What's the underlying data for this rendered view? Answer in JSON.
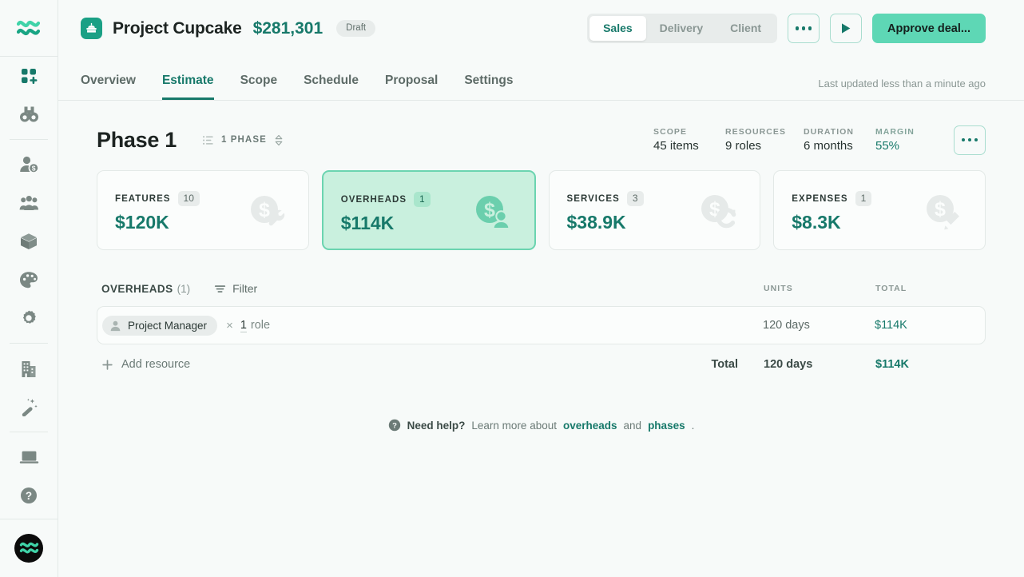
{
  "sidebar": {
    "logo_icon": "waves-logo-icon",
    "items": [
      {
        "icon": "grid-plus-icon",
        "name": "sidebar-item-dashboard",
        "active": true
      },
      {
        "icon": "binoculars-icon",
        "name": "sidebar-item-discover",
        "active": false
      },
      {
        "icon": "person-dollar-icon",
        "name": "sidebar-item-deals",
        "active": false
      },
      {
        "icon": "team-icon",
        "name": "sidebar-item-team",
        "active": false
      },
      {
        "icon": "box-icon",
        "name": "sidebar-item-products",
        "active": false
      },
      {
        "icon": "palette-icon",
        "name": "sidebar-item-branding",
        "active": false
      },
      {
        "icon": "gear-icon",
        "name": "sidebar-item-settings",
        "active": false
      },
      {
        "icon": "building-icon",
        "name": "sidebar-item-company",
        "active": false
      },
      {
        "icon": "magic-wand-icon",
        "name": "sidebar-item-automations",
        "active": false
      },
      {
        "icon": "laptop-icon",
        "name": "sidebar-item-presentations",
        "active": false
      },
      {
        "icon": "help-circle-icon",
        "name": "sidebar-item-help",
        "active": false
      }
    ],
    "avatar_icon": "user-avatar-waves-icon"
  },
  "topbar": {
    "project_icon": "cupcake-icon",
    "project_title": "Project Cupcake",
    "project_amount": "$281,301",
    "status_badge": "Draft",
    "segments": [
      {
        "label": "Sales",
        "active": true
      },
      {
        "label": "Delivery",
        "active": false
      },
      {
        "label": "Client",
        "active": false
      }
    ],
    "more_icon": "ellipsis-icon",
    "play_icon": "play-icon",
    "approve_label": "Approve deal..."
  },
  "tabs": {
    "items": [
      {
        "label": "Overview",
        "active": false
      },
      {
        "label": "Estimate",
        "active": true
      },
      {
        "label": "Scope",
        "active": false
      },
      {
        "label": "Schedule",
        "active": false
      },
      {
        "label": "Proposal",
        "active": false
      },
      {
        "label": "Settings",
        "active": false
      }
    ],
    "last_updated": "Last updated less than a minute ago"
  },
  "phase": {
    "title": "Phase 1",
    "selector_icon": "list-ordered-icon",
    "selector_label": "1 PHASE",
    "selector_chevron_icon": "chevron-up-down-icon",
    "metrics": [
      {
        "label": "SCOPE",
        "value": "45 items",
        "highlight": false
      },
      {
        "label": "RESOURCES",
        "value": "9 roles",
        "highlight": false
      },
      {
        "label": "DURATION",
        "value": "6 months",
        "highlight": false
      },
      {
        "label": "MARGIN",
        "value": "55%",
        "highlight": true
      }
    ],
    "menu_icon": "ellipsis-icon"
  },
  "cards": [
    {
      "label": "FEATURES",
      "count": "10",
      "value": "$120K",
      "icon": "dollar-wrench-icon",
      "selected": false
    },
    {
      "label": "OVERHEADS",
      "count": "1",
      "value": "$114K",
      "icon": "dollar-person-icon",
      "selected": true
    },
    {
      "label": "SERVICES",
      "count": "3",
      "value": "$38.9K",
      "icon": "dollar-refresh-icon",
      "selected": false
    },
    {
      "label": "EXPENSES",
      "count": "1",
      "value": "$8.3K",
      "icon": "dollar-pen-icon",
      "selected": false
    }
  ],
  "table": {
    "title": "OVERHEADS",
    "count": "(1)",
    "filter_icon": "filter-icon",
    "filter_label": "Filter",
    "col_units": "UNITS",
    "col_total": "TOTAL",
    "rows": [
      {
        "role_icon": "person-icon",
        "role": "Project Manager",
        "multiply": "×",
        "qty": "1",
        "qty_unit": "role",
        "units": "120 days",
        "total": "$114K"
      }
    ],
    "add_icon": "plus-icon",
    "add_label": "Add resource",
    "total_label": "Total",
    "total_units": "120 days",
    "total_amount": "$114K"
  },
  "help": {
    "icon": "question-circle-icon",
    "lead": "Need help?",
    "middle": " Learn more about ",
    "link1": "overheads",
    "conjunction": " and ",
    "link2": "phases",
    "period": "."
  },
  "colors": {
    "brand_green": "#17796a",
    "accent_mint": "#5ed7b5",
    "selected_card_bg": "#c9f0de",
    "page_bg": "#f7faf9",
    "muted_text": "#8a9794"
  }
}
